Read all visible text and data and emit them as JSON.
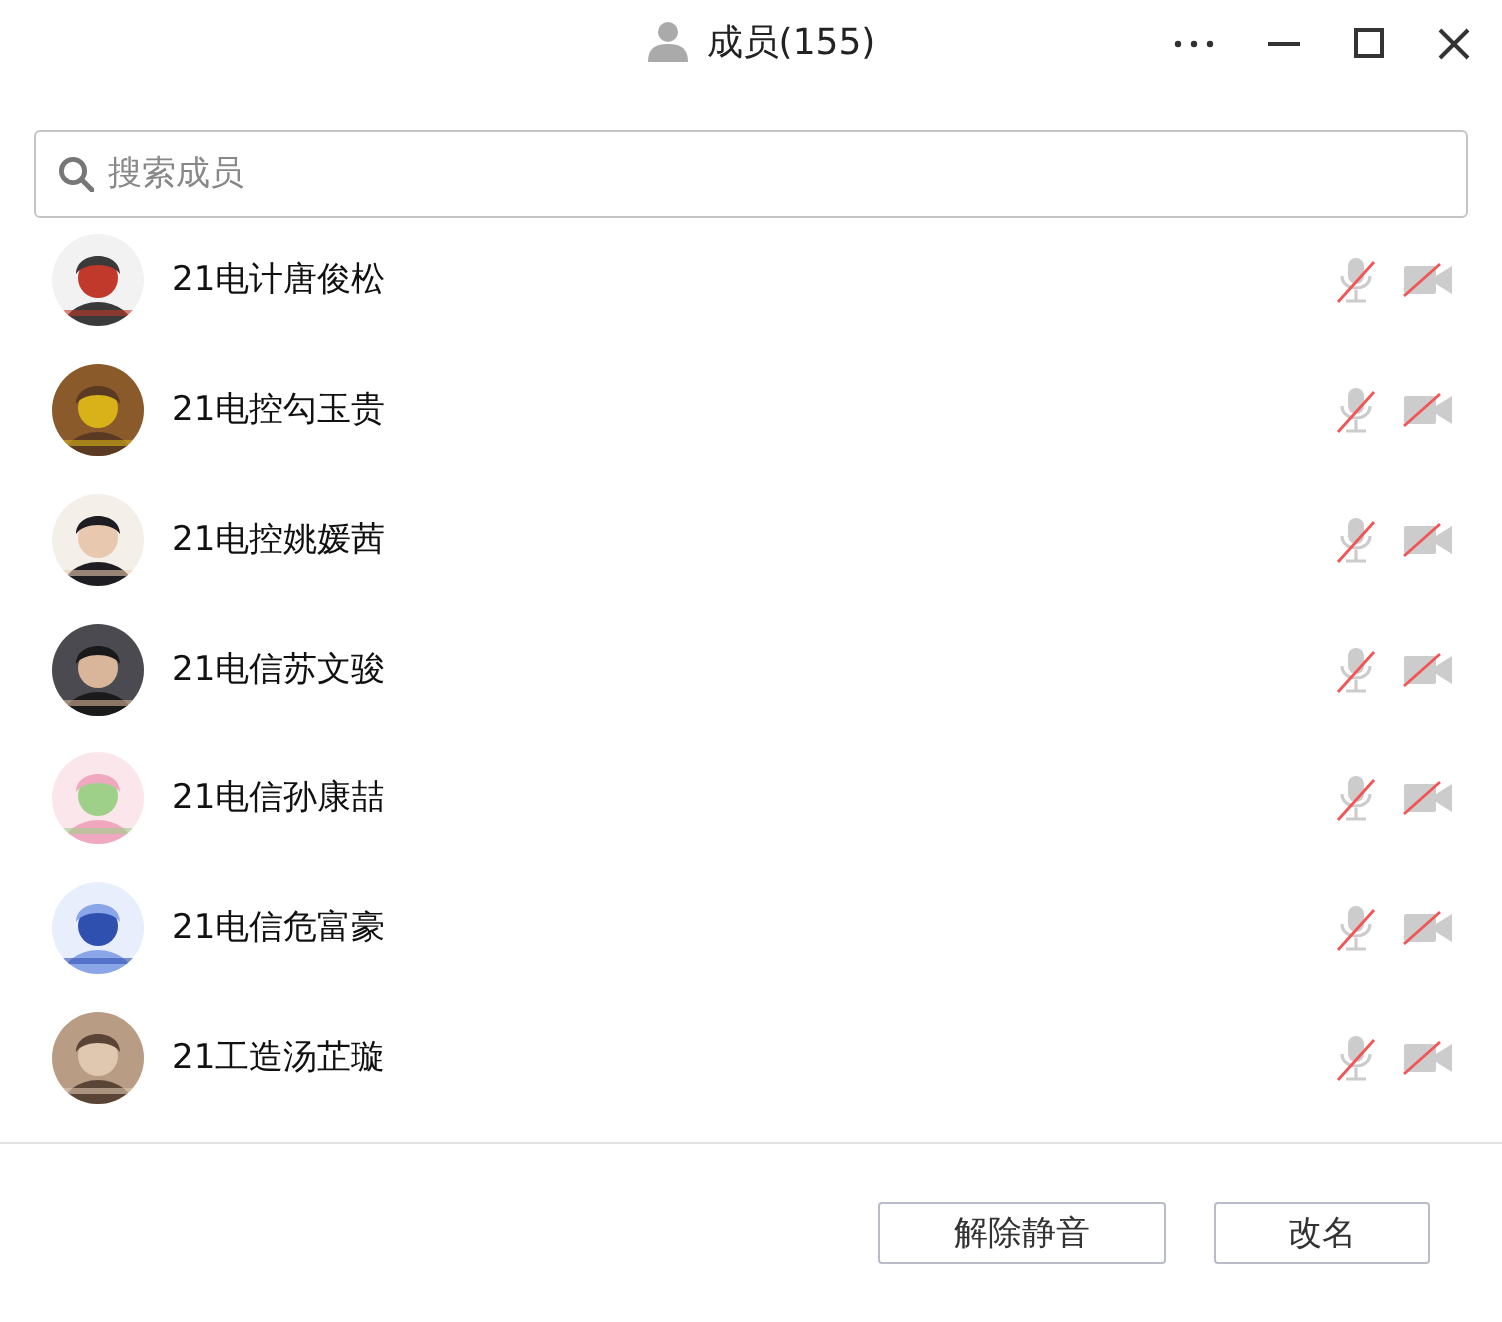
{
  "window": {
    "title": "成员(155)"
  },
  "search": {
    "placeholder": "搜索成员"
  },
  "members": [
    {
      "name": "21电计唐俊松",
      "mic_muted": true,
      "video_off": true
    },
    {
      "name": "21电控勾玉贵",
      "mic_muted": true,
      "video_off": true
    },
    {
      "name": "21电控姚媛茜",
      "mic_muted": true,
      "video_off": true
    },
    {
      "name": "21电信苏文骏",
      "mic_muted": true,
      "video_off": true
    },
    {
      "name": "21电信孙康喆",
      "mic_muted": true,
      "video_off": true
    },
    {
      "name": "21电信危富豪",
      "mic_muted": true,
      "video_off": true
    },
    {
      "name": "21工造汤芷璇",
      "mic_muted": true,
      "video_off": true
    }
  ],
  "buttons": [
    "解除静音",
    "改名"
  ]
}
